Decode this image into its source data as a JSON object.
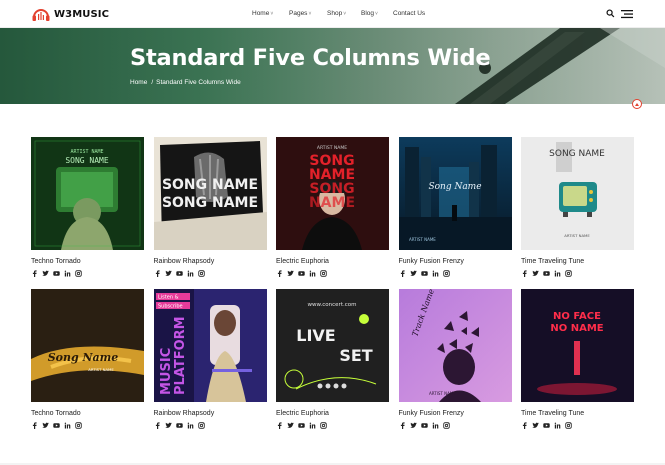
{
  "header": {
    "logo_text": "W3MUSIC",
    "nav": [
      {
        "label": "Home",
        "has_caret": true
      },
      {
        "label": "Pages",
        "has_caret": true
      },
      {
        "label": "Shop",
        "has_caret": true
      },
      {
        "label": "Blog",
        "has_caret": true
      },
      {
        "label": "Contact Us",
        "has_caret": false
      }
    ],
    "caret": "˅",
    "icons": [
      "search-icon",
      "menu-icon"
    ]
  },
  "hero": {
    "title": "Standard Five Columns Wide",
    "breadcrumb": {
      "home": "Home",
      "separator": "/",
      "current": "Standard Five Columns Wide"
    }
  },
  "colors": {
    "brand_red": "#e3412f",
    "text_dark": "#222222",
    "hero_green": "#2c6546"
  },
  "social_icons": [
    "facebook-icon",
    "twitter-icon",
    "youtube-icon",
    "linkedin-icon",
    "instagram-icon"
  ],
  "cards": [
    {
      "title": "Techno Tornado",
      "cover": {
        "lines": [
          "ARTIST NAME",
          "SONG NAME"
        ],
        "style": "green-monitor"
      }
    },
    {
      "title": "Rainbow Rhapsody",
      "cover": {
        "lines": [
          "SONG NAME",
          "SONG NAME"
        ],
        "style": "torn-paper"
      }
    },
    {
      "title": "Electric Euphoria",
      "cover": {
        "lines": [
          "ARTIST NAME",
          "SONG",
          "NAME",
          "SONG",
          "NAME"
        ],
        "style": "red-portrait"
      }
    },
    {
      "title": "Funky Fusion Frenzy",
      "cover": {
        "lines": [
          "Song Name",
          "ARTIST NAME"
        ],
        "style": "blue-city"
      }
    },
    {
      "title": "Time Traveling Tune",
      "cover": {
        "lines": [
          "SONG NAME",
          "ARTIST NAME"
        ],
        "style": "retro-tv"
      }
    },
    {
      "title": "Techno Tornado",
      "cover": {
        "lines": [
          "Song Name",
          "ARTIST NAME"
        ],
        "style": "gold-stroke"
      }
    },
    {
      "title": "Rainbow Rhapsody",
      "cover": {
        "lines": [
          "Listen &",
          "Subscribe",
          "MUSIC",
          "PLATFORM"
        ],
        "style": "purple-platform"
      }
    },
    {
      "title": "Electric Euphoria",
      "cover": {
        "lines": [
          "www.concert.com",
          "LIVE",
          "SET"
        ],
        "style": "live-set"
      }
    },
    {
      "title": "Funky Fusion Frenzy",
      "cover": {
        "lines": [
          "Track Name",
          "ARTIST NAME"
        ],
        "style": "butterflies"
      }
    },
    {
      "title": "Time Traveling Tune",
      "cover": {
        "lines": [
          "NO FACE",
          "NO NAME"
        ],
        "style": "red-neon"
      }
    }
  ]
}
